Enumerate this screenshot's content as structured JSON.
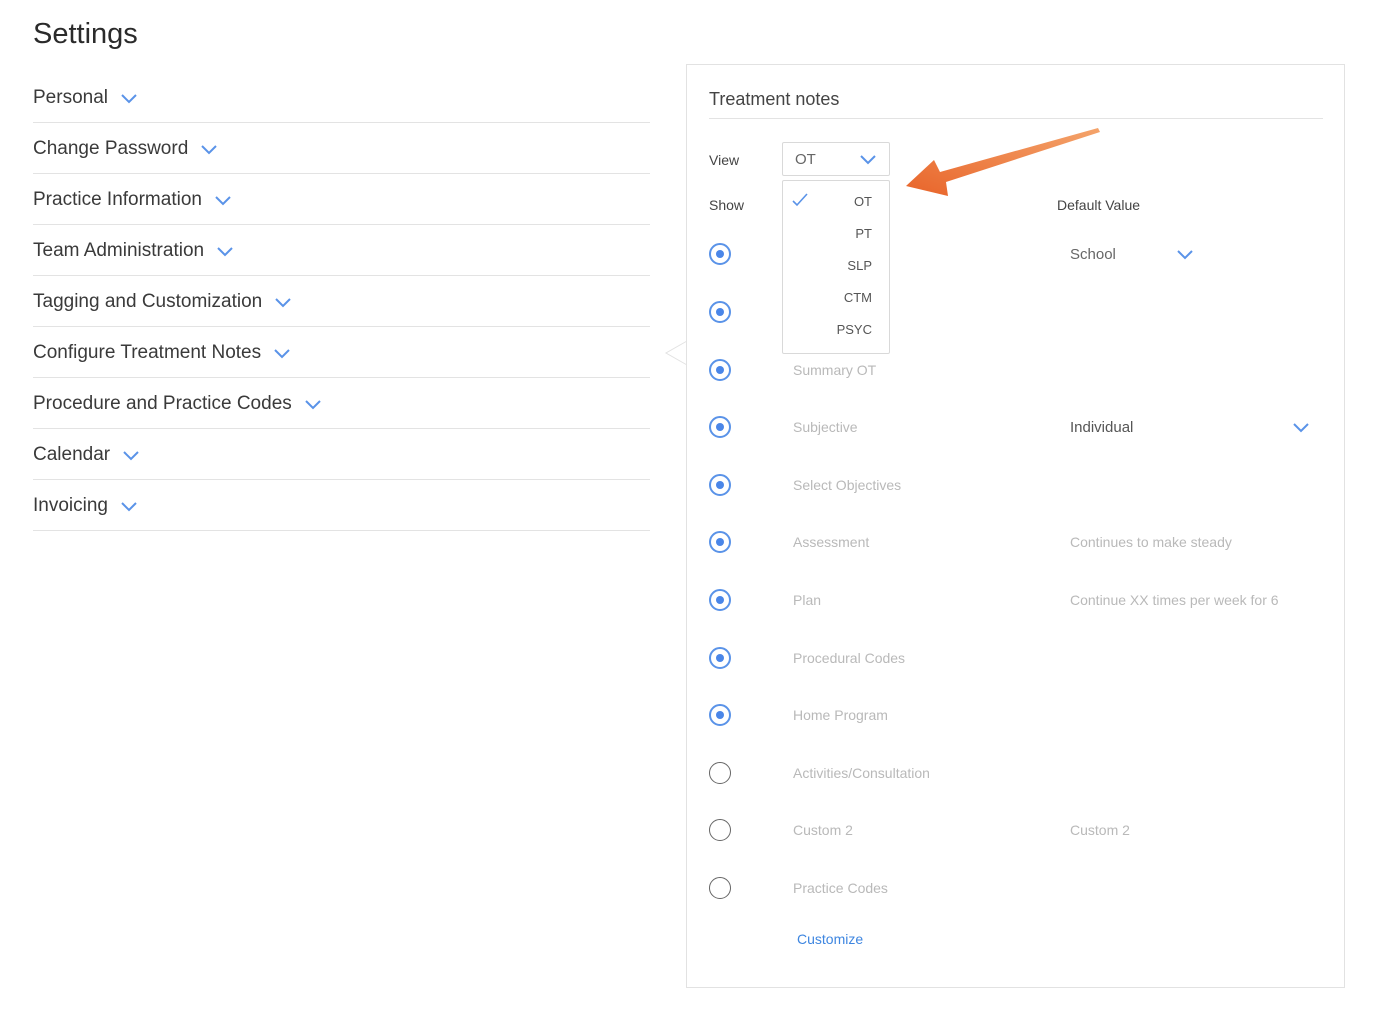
{
  "page": {
    "title": "Settings"
  },
  "sections": [
    {
      "label": "Personal"
    },
    {
      "label": "Change Password"
    },
    {
      "label": "Practice Information"
    },
    {
      "label": "Team Administration"
    },
    {
      "label": "Tagging and Customization"
    },
    {
      "label": "Configure Treatment Notes"
    },
    {
      "label": "Procedure and Practice Codes"
    },
    {
      "label": "Calendar"
    },
    {
      "label": "Invoicing"
    }
  ],
  "treatment_notes": {
    "title": "Treatment notes",
    "view_label": "View",
    "view_value": "OT",
    "show_label": "Show",
    "default_value_label": "Default Value",
    "dropdown_options": [
      "OT",
      "PT",
      "SLP",
      "CTM",
      "PSYC"
    ],
    "dropdown_selected": "OT",
    "rows": [
      {
        "label": "",
        "checked": true,
        "default": "School",
        "default_type": "select"
      },
      {
        "label": "",
        "checked": true,
        "default": "",
        "default_type": "none"
      },
      {
        "label": "Summary OT",
        "checked": true,
        "default": "",
        "default_type": "none"
      },
      {
        "label": "Subjective",
        "checked": true,
        "default": "Individual",
        "default_type": "select"
      },
      {
        "label": "Select Objectives",
        "checked": true,
        "default": "",
        "default_type": "none"
      },
      {
        "label": "Assessment",
        "checked": true,
        "default": "Continues to make steady",
        "default_type": "text"
      },
      {
        "label": "Plan",
        "checked": true,
        "default": "Continue XX times per week for 6",
        "default_type": "text"
      },
      {
        "label": "Procedural Codes",
        "checked": true,
        "default": "",
        "default_type": "none"
      },
      {
        "label": "Home Program",
        "checked": true,
        "default": "",
        "default_type": "none"
      },
      {
        "label": "Activities/Consultation",
        "checked": false,
        "default": "",
        "default_type": "none"
      },
      {
        "label": "Custom 2",
        "checked": false,
        "default": "Custom 2",
        "default_type": "text"
      },
      {
        "label": "Practice Codes",
        "checked": false,
        "default": "",
        "default_type": "none"
      }
    ],
    "customize_label": "Customize"
  },
  "colors": {
    "accent": "#4a86e8",
    "arrow": "#e8702a",
    "muted_text": "#b9b9b9"
  }
}
